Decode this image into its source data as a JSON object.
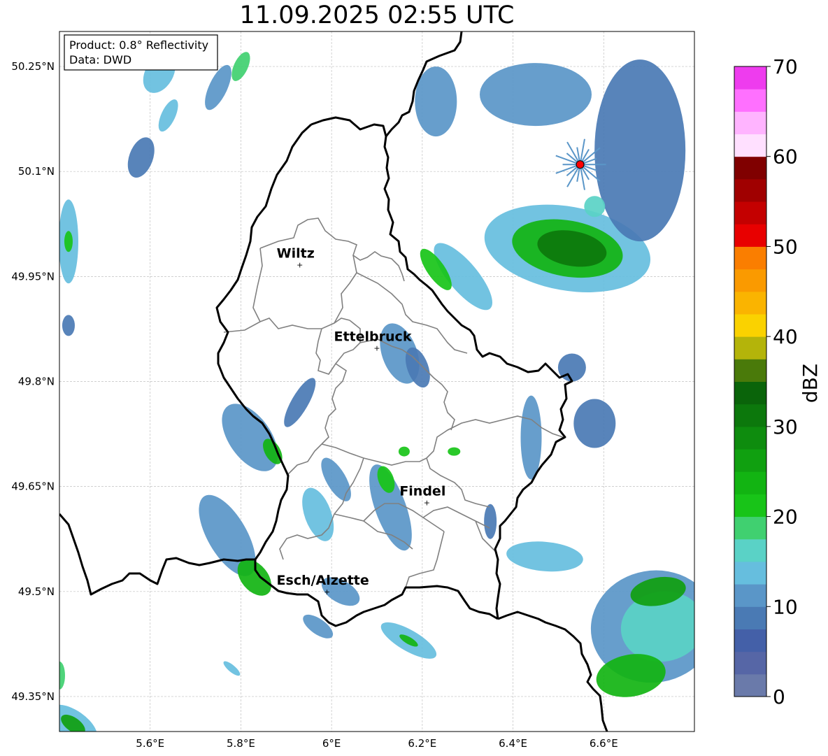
{
  "title": "11.09.2025 02:55 UTC",
  "info_box": {
    "product": "Product: 0.8° Reflectivity",
    "data": "Data: DWD"
  },
  "lat_ticks": [
    {
      "value": 50.25,
      "label": "50.25°N"
    },
    {
      "value": 50.1,
      "label": "50.1°N"
    },
    {
      "value": 49.95,
      "label": "49.95°N"
    },
    {
      "value": 49.8,
      "label": "49.8°N"
    },
    {
      "value": 49.65,
      "label": "49.65°N"
    },
    {
      "value": 49.5,
      "label": "49.5°N"
    },
    {
      "value": 49.35,
      "label": "49.35°N"
    }
  ],
  "lon_ticks": [
    {
      "value": 5.6,
      "label": "5.6°E"
    },
    {
      "value": 5.8,
      "label": "5.8°E"
    },
    {
      "value": 6.0,
      "label": "6°E"
    },
    {
      "value": 6.2,
      "label": "6.2°E"
    },
    {
      "value": 6.4,
      "label": "6.4°E"
    },
    {
      "value": 6.6,
      "label": "6.6°E"
    }
  ],
  "extent": {
    "lon_min": 5.4,
    "lon_max": 6.8,
    "lat_min": 49.3,
    "lat_max": 50.3
  },
  "cities": [
    {
      "name": "Wiltz",
      "lon": 5.93,
      "lat": 49.967
    },
    {
      "name": "Ettelbruck",
      "lon": 6.1,
      "lat": 49.848
    },
    {
      "name": "Findel",
      "lon": 6.21,
      "lat": 49.627
    },
    {
      "name": "Esch/Alzette",
      "lon": 5.99,
      "lat": 49.5
    }
  ],
  "radar_site": {
    "lon": 6.548,
    "lat": 50.11,
    "color": "#ff0000"
  },
  "colorbar": {
    "label": "dBZ",
    "min": 0,
    "max": 70,
    "ticks": [
      0,
      10,
      20,
      30,
      40,
      50,
      60,
      70
    ],
    "colors": [
      "#6a7aaa",
      "#5666a6",
      "#4460a8",
      "#4a7ab4",
      "#5a96c8",
      "#66bede",
      "#5ad2c6",
      "#40d070",
      "#18c418",
      "#12b412",
      "#10a010",
      "#0e8c0e",
      "#0c780c",
      "#0a640a",
      "#4a7a0a",
      "#b4b40a",
      "#fad200",
      "#fab400",
      "#fa9a00",
      "#fa7e00",
      "#e80000",
      "#c40000",
      "#a00000",
      "#800000",
      "#ffe0ff",
      "#ffb4ff",
      "#ff70ff",
      "#ee3cee"
    ]
  },
  "colors": {
    "border": "#000000",
    "canton": "#808080",
    "grid": "#c0c0c0"
  },
  "echoes": [
    {
      "lon": 5.62,
      "lat": 50.24,
      "w": 40,
      "h": 60,
      "rot": 30,
      "c": 5
    },
    {
      "lon": 5.75,
      "lat": 50.22,
      "w": 26,
      "h": 70,
      "rot": 25,
      "c": 4
    },
    {
      "lon": 5.8,
      "lat": 50.25,
      "w": 20,
      "h": 45,
      "rot": 25,
      "c": 7
    },
    {
      "lon": 5.58,
      "lat": 50.12,
      "w": 34,
      "h": 60,
      "rot": 20,
      "c": 3
    },
    {
      "lon": 5.64,
      "lat": 50.18,
      "w": 20,
      "h": 50,
      "rot": 25,
      "c": 5
    },
    {
      "lon": 5.42,
      "lat": 50.0,
      "w": 28,
      "h": 120,
      "rot": 0,
      "c": 5
    },
    {
      "lon": 5.42,
      "lat": 50.0,
      "w": 12,
      "h": 30,
      "rot": 0,
      "c": 8
    },
    {
      "lon": 5.42,
      "lat": 49.88,
      "w": 18,
      "h": 30,
      "rot": 0,
      "c": 3
    },
    {
      "lon": 6.29,
      "lat": 49.95,
      "w": 42,
      "h": 120,
      "rot": -40,
      "c": 5
    },
    {
      "lon": 6.23,
      "lat": 49.96,
      "w": 25,
      "h": 70,
      "rot": -35,
      "c": 8
    },
    {
      "lon": 6.52,
      "lat": 49.99,
      "w": 240,
      "h": 120,
      "rot": 10,
      "c": 5
    },
    {
      "lon": 6.52,
      "lat": 49.99,
      "w": 160,
      "h": 80,
      "rot": 10,
      "c": 9
    },
    {
      "lon": 6.53,
      "lat": 49.99,
      "w": 100,
      "h": 50,
      "rot": 10,
      "c": 12
    },
    {
      "lon": 6.68,
      "lat": 50.13,
      "w": 130,
      "h": 260,
      "rot": 0,
      "c": 3
    },
    {
      "lon": 6.45,
      "lat": 50.21,
      "w": 160,
      "h": 90,
      "rot": 0,
      "c": 4
    },
    {
      "lon": 6.23,
      "lat": 50.2,
      "w": 60,
      "h": 100,
      "rot": 0,
      "c": 4
    },
    {
      "lon": 6.58,
      "lat": 50.05,
      "w": 30,
      "h": 30,
      "rot": 0,
      "c": 6
    },
    {
      "lon": 6.15,
      "lat": 49.84,
      "w": 50,
      "h": 90,
      "rot": -20,
      "c": 4
    },
    {
      "lon": 6.19,
      "lat": 49.82,
      "w": 30,
      "h": 60,
      "rot": -20,
      "c": 3
    },
    {
      "lon": 5.82,
      "lat": 49.72,
      "w": 60,
      "h": 110,
      "rot": -35,
      "c": 4
    },
    {
      "lon": 5.87,
      "lat": 49.7,
      "w": 22,
      "h": 40,
      "rot": -30,
      "c": 9
    },
    {
      "lon": 5.93,
      "lat": 49.77,
      "w": 24,
      "h": 80,
      "rot": 30,
      "c": 3
    },
    {
      "lon": 5.77,
      "lat": 49.58,
      "w": 56,
      "h": 130,
      "rot": -30,
      "c": 4
    },
    {
      "lon": 5.83,
      "lat": 49.52,
      "w": 38,
      "h": 60,
      "rot": -40,
      "c": 9
    },
    {
      "lon": 5.97,
      "lat": 49.61,
      "w": 38,
      "h": 80,
      "rot": -20,
      "c": 5
    },
    {
      "lon": 6.01,
      "lat": 49.66,
      "w": 28,
      "h": 70,
      "rot": -30,
      "c": 4
    },
    {
      "lon": 6.13,
      "lat": 49.62,
      "w": 44,
      "h": 130,
      "rot": -20,
      "c": 4
    },
    {
      "lon": 6.12,
      "lat": 49.66,
      "w": 22,
      "h": 40,
      "rot": -20,
      "c": 8
    },
    {
      "lon": 6.02,
      "lat": 49.5,
      "w": 32,
      "h": 60,
      "rot": -60,
      "c": 4
    },
    {
      "lon": 5.97,
      "lat": 49.45,
      "w": 22,
      "h": 50,
      "rot": -55,
      "c": 4
    },
    {
      "lon": 6.17,
      "lat": 49.43,
      "w": 30,
      "h": 90,
      "rot": -60,
      "c": 5
    },
    {
      "lon": 6.17,
      "lat": 49.43,
      "w": 10,
      "h": 30,
      "rot": -60,
      "c": 9
    },
    {
      "lon": 6.47,
      "lat": 49.55,
      "w": 42,
      "h": 110,
      "rot": -85,
      "c": 5
    },
    {
      "lon": 6.44,
      "lat": 49.72,
      "w": 30,
      "h": 120,
      "rot": 0,
      "c": 4
    },
    {
      "lon": 6.35,
      "lat": 49.6,
      "w": 18,
      "h": 50,
      "rot": 0,
      "c": 3
    },
    {
      "lon": 6.71,
      "lat": 49.45,
      "w": 180,
      "h": 160,
      "rot": -10,
      "c": 4
    },
    {
      "lon": 6.73,
      "lat": 49.45,
      "w": 120,
      "h": 100,
      "rot": -10,
      "c": 6
    },
    {
      "lon": 6.66,
      "lat": 49.38,
      "w": 100,
      "h": 60,
      "rot": -10,
      "c": 9
    },
    {
      "lon": 6.72,
      "lat": 49.5,
      "w": 80,
      "h": 40,
      "rot": -10,
      "c": 10
    },
    {
      "lon": 6.58,
      "lat": 49.74,
      "w": 60,
      "h": 70,
      "rot": 0,
      "c": 3
    },
    {
      "lon": 6.53,
      "lat": 49.82,
      "w": 40,
      "h": 40,
      "rot": 0,
      "c": 3
    },
    {
      "lon": 5.43,
      "lat": 49.31,
      "w": 80,
      "h": 40,
      "rot": 35,
      "c": 5
    },
    {
      "lon": 5.43,
      "lat": 49.31,
      "w": 40,
      "h": 20,
      "rot": 35,
      "c": 10
    },
    {
      "lon": 5.4,
      "lat": 49.38,
      "w": 16,
      "h": 40,
      "rot": 0,
      "c": 7
    },
    {
      "lon": 5.78,
      "lat": 49.39,
      "w": 30,
      "h": 10,
      "rot": 40,
      "c": 5
    },
    {
      "lon": 6.27,
      "lat": 49.7,
      "w": 18,
      "h": 12,
      "rot": 0,
      "c": 8
    },
    {
      "lon": 6.16,
      "lat": 49.7,
      "w": 16,
      "h": 14,
      "rot": 0,
      "c": 8
    }
  ]
}
